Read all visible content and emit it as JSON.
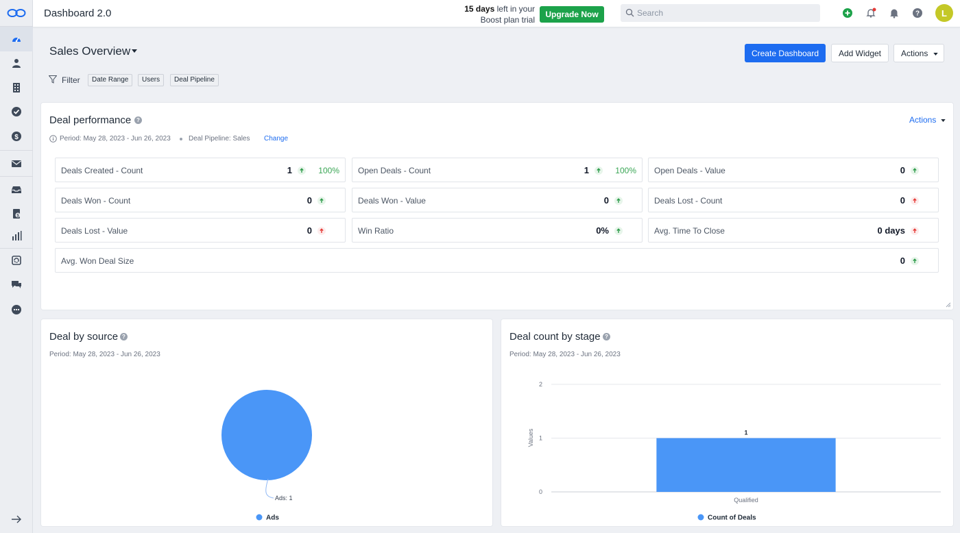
{
  "header": {
    "title": "Dashboard 2.0",
    "trial_days": "15 days",
    "trial_rest": "left in your",
    "trial_plan": "Boost plan trial",
    "upgrade_label": "Upgrade Now",
    "search_placeholder": "Search",
    "avatar_initial": "L"
  },
  "toolbar": {
    "page_title": "Sales Overview",
    "create_dashboard": "Create Dashboard",
    "add_widget": "Add Widget",
    "actions": "Actions"
  },
  "filter": {
    "label": "Filter",
    "chips": [
      "Date Range",
      "Users",
      "Deal Pipeline"
    ]
  },
  "deal_performance": {
    "title": "Deal performance",
    "period": "Period: May 28, 2023 - Jun 26, 2023",
    "pipeline": "Deal Pipeline: Sales",
    "change": "Change",
    "actions": "Actions",
    "metrics": [
      {
        "label": "Deals Created - Count",
        "value": "1",
        "pct": "100%",
        "trend": "up"
      },
      {
        "label": "Open Deals - Count",
        "value": "1",
        "pct": "100%",
        "trend": "up"
      },
      {
        "label": "Open Deals - Value",
        "value": "0",
        "pct": "",
        "trend": "up"
      },
      {
        "label": "Deals Won - Count",
        "value": "0",
        "pct": "",
        "trend": "up"
      },
      {
        "label": "Deals Won - Value",
        "value": "0",
        "pct": "",
        "trend": "up"
      },
      {
        "label": "Deals Lost - Count",
        "value": "0",
        "pct": "",
        "trend": "down"
      },
      {
        "label": "Deals Lost - Value",
        "value": "0",
        "pct": "",
        "trend": "down"
      },
      {
        "label": "Win Ratio",
        "value": "0%",
        "pct": "",
        "trend": "up"
      },
      {
        "label": "Avg. Time To Close",
        "value": "0 days",
        "pct": "",
        "trend": "down"
      },
      {
        "label": "Avg. Won Deal Size",
        "value": "0",
        "pct": "",
        "trend": "up"
      }
    ]
  },
  "deal_by_source": {
    "title": "Deal by source",
    "period": "Period: May 28, 2023 - Jun 26, 2023"
  },
  "deal_count_by_stage": {
    "title": "Deal count by stage",
    "period": "Period: May 28, 2023 - Jun 26, 2023"
  },
  "colors": {
    "accent": "#1d6cf0",
    "upgrade": "#1ca24a",
    "chart": "#4a96f7"
  },
  "chart_data": [
    {
      "type": "pie",
      "categories": [
        "Ads"
      ],
      "values": [
        1
      ],
      "title": "",
      "data_labels": [
        "Ads: 1"
      ],
      "legend": [
        "Ads"
      ],
      "legend_position": "bottom"
    },
    {
      "type": "bar",
      "categories": [
        "Qualified"
      ],
      "series": [
        {
          "name": "Count of Deals",
          "values": [
            1
          ]
        }
      ],
      "title": "",
      "xlabel": "",
      "ylabel": "Values",
      "ylim": [
        0,
        2
      ],
      "yticks": [
        "0",
        "1",
        "2"
      ],
      "data_labels": [
        "1"
      ],
      "grid": true,
      "legend_position": "bottom"
    }
  ]
}
